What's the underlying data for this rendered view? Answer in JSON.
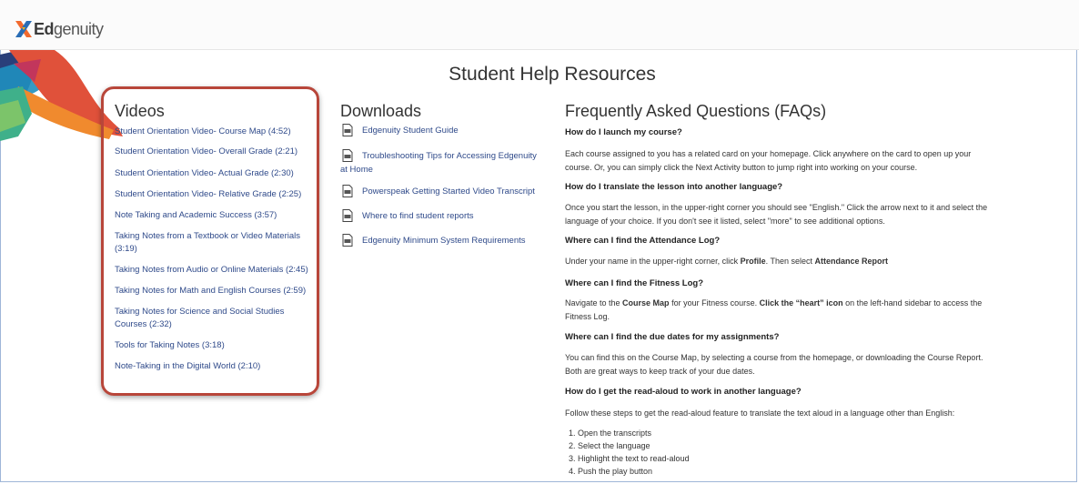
{
  "header": {
    "logo_text_bold": "Ed",
    "logo_text": "genuity"
  },
  "page": {
    "title": "Student Help Resources"
  },
  "videos": {
    "heading": "Videos",
    "items": [
      "Student Orientation Video- Course Map (4:52)",
      "Student Orientation Video- Overall Grade (2:21)",
      "Student Orientation Video- Actual Grade (2:30)",
      "Student Orientation Video- Relative Grade (2:25)",
      "Note Taking and Academic Success (3:57)",
      "Taking Notes from a Textbook or Video Materials (3:19)",
      "Taking Notes from Audio or Online Materials (2:45)",
      "Taking Notes for Math and English Courses (2:59)",
      "Taking Notes for Science and Social Studies Courses (2:32)",
      "Tools for Taking Notes (3:18)",
      "Note-Taking in the Digital World (2:10)"
    ]
  },
  "downloads": {
    "heading": "Downloads",
    "items": [
      "Edgenuity Student Guide",
      "Troubleshooting Tips for Accessing Edgenuity at Home",
      "Powerspeak Getting Started Video Transcript",
      "Where to find student reports",
      "Edgenuity Minimum System Requirements"
    ]
  },
  "faq": {
    "heading": "Frequently Asked Questions (FAQs)",
    "q1": "How do I launch my course?",
    "a1": "Each course assigned to you has a related card on your homepage. Click anywhere on the card to open up your course. Or, you can simply click the Next Activity button to jump right into working on your course.",
    "q2": "How do I translate the lesson into another language?",
    "a2": "Once you start the lesson, in the upper-right corner you should see \"English.\" Click the arrow next to it and select the language of your choice. If you don't see it listed, select \"more\" to see additional options.",
    "q3": "Where can I find the Attendance Log?",
    "a3_pre": "Under your name in the upper-right corner, click ",
    "a3_b1": "Profile",
    "a3_mid": ". Then select ",
    "a3_b2": "Attendance Report",
    "q4": "Where can I find the Fitness Log?",
    "a4_pre": "Navigate to the ",
    "a4_b1": "Course Map",
    "a4_mid": " for your Fitness course. ",
    "a4_b2": "Click the “heart” icon",
    "a4_post": " on the left-hand sidebar to access the Fitness Log.",
    "q5": "Where can I find the due dates for my assignments?",
    "a5": "You can find this on the Course Map, by selecting a course from the homepage, or downloading the Course Report. Both are great ways to keep track of your due dates.",
    "q6": "How do I get the read-aloud to work in another language?",
    "a6": "Follow these steps to get the read-aloud feature to translate the text aloud in a language other than English:",
    "steps": [
      "Open the transcripts",
      "Select the language",
      "Highlight the text to read-aloud",
      "Push the play button"
    ]
  },
  "colors": {
    "link": "#2f4a8a",
    "highlight_border": "#b8463a",
    "brand_orange": "#f26a2e",
    "brand_blue": "#2a6db5"
  }
}
